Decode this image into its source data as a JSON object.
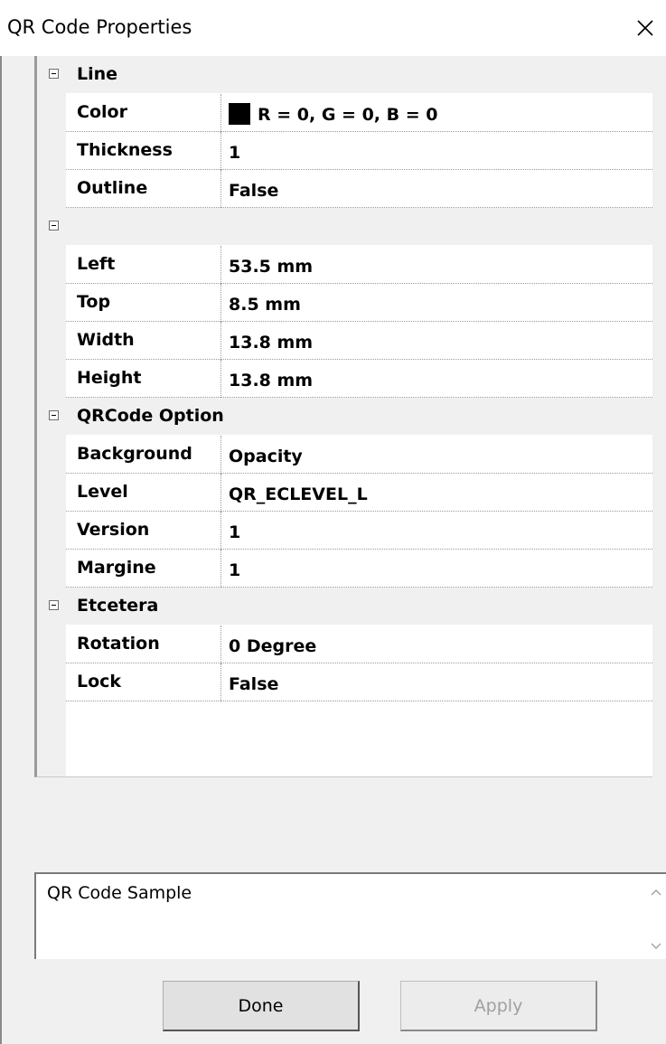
{
  "window": {
    "title": "QR Code Properties",
    "close_icon": "close-icon"
  },
  "grid": {
    "categories": [
      {
        "label": "Line",
        "props": [
          {
            "name": "Color",
            "value": "R = 0, G = 0, B = 0",
            "swatch": "#000000"
          },
          {
            "name": "Thickness",
            "value": "1"
          },
          {
            "name": "Outline",
            "value": "False"
          }
        ]
      },
      {
        "label": "",
        "props": [
          {
            "name": "Left",
            "value": "53.5 mm"
          },
          {
            "name": "Top",
            "value": "8.5 mm"
          },
          {
            "name": "Width",
            "value": "13.8 mm"
          },
          {
            "name": "Height",
            "value": "13.8 mm"
          }
        ]
      },
      {
        "label": "QRCode Option",
        "props": [
          {
            "name": "Background",
            "value": "Opacity"
          },
          {
            "name": "Level",
            "value": "QR_ECLEVEL_L"
          },
          {
            "name": "Version",
            "value": "1"
          },
          {
            "name": "Margine",
            "value": "1"
          }
        ]
      },
      {
        "label": "Etcetera",
        "props": [
          {
            "name": "Rotation",
            "value": "0 Degree"
          },
          {
            "name": "Lock",
            "value": "False"
          }
        ]
      }
    ]
  },
  "description": {
    "text": "QR Code Sample"
  },
  "buttons": {
    "done_label": "Done",
    "apply_label": "Apply"
  }
}
